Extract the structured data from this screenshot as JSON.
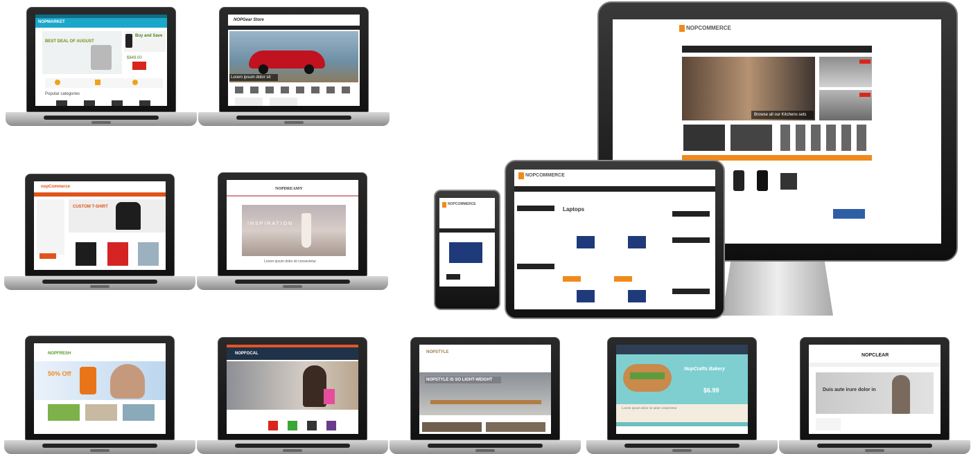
{
  "screens": {
    "nopmarket": {
      "logo": "NOPMARKET",
      "banner": "BEST DEAL OF AUGUST",
      "promo": "Buy and Save",
      "price": "$849.00",
      "section": "Popular categories"
    },
    "nopgear": {
      "logo": "NOPGear Store",
      "caption": "Lorem ipsum dolor sit"
    },
    "nopcommerce_a": {
      "logo": "nopCommerce",
      "headline": "CUSTOM T-SHIRT"
    },
    "nopdreamy": {
      "logo": "NOPDREAMY",
      "banner": "INSPIRATION",
      "caption": "Lorem ipsum dolor sit consectetur"
    },
    "nopfresh": {
      "logo": "NOPFRESH",
      "offer": "50% Off"
    },
    "nopfocal": {
      "logo": "NOPFOCAL"
    },
    "nopstyle": {
      "logo": "NOPSTYLE",
      "banner": "NOPSTYLE IS SO LIGHT-WEIGHT"
    },
    "nopcrafts": {
      "banner": "NopCrafts Bakery",
      "price": "$6.99",
      "caption": "Lorem ipsum dolor sit amet consectetur"
    },
    "nopclear": {
      "logo": "NOPCLEAR",
      "banner": "Duis aute irure dolor in"
    },
    "monitor": {
      "logo": "NOPCOMMERCE",
      "caption": "Browse all our Kitchens sets"
    },
    "tablet": {
      "logo": "NOPCOMMERCE",
      "heading": "Laptops"
    },
    "phone": {
      "logo": "NOPCOMMERCE"
    }
  },
  "colors": {
    "accent_orange": "#f08a1c",
    "teal": "#1aa7c9",
    "red": "#d9261c",
    "dark_nav": "#222222"
  }
}
